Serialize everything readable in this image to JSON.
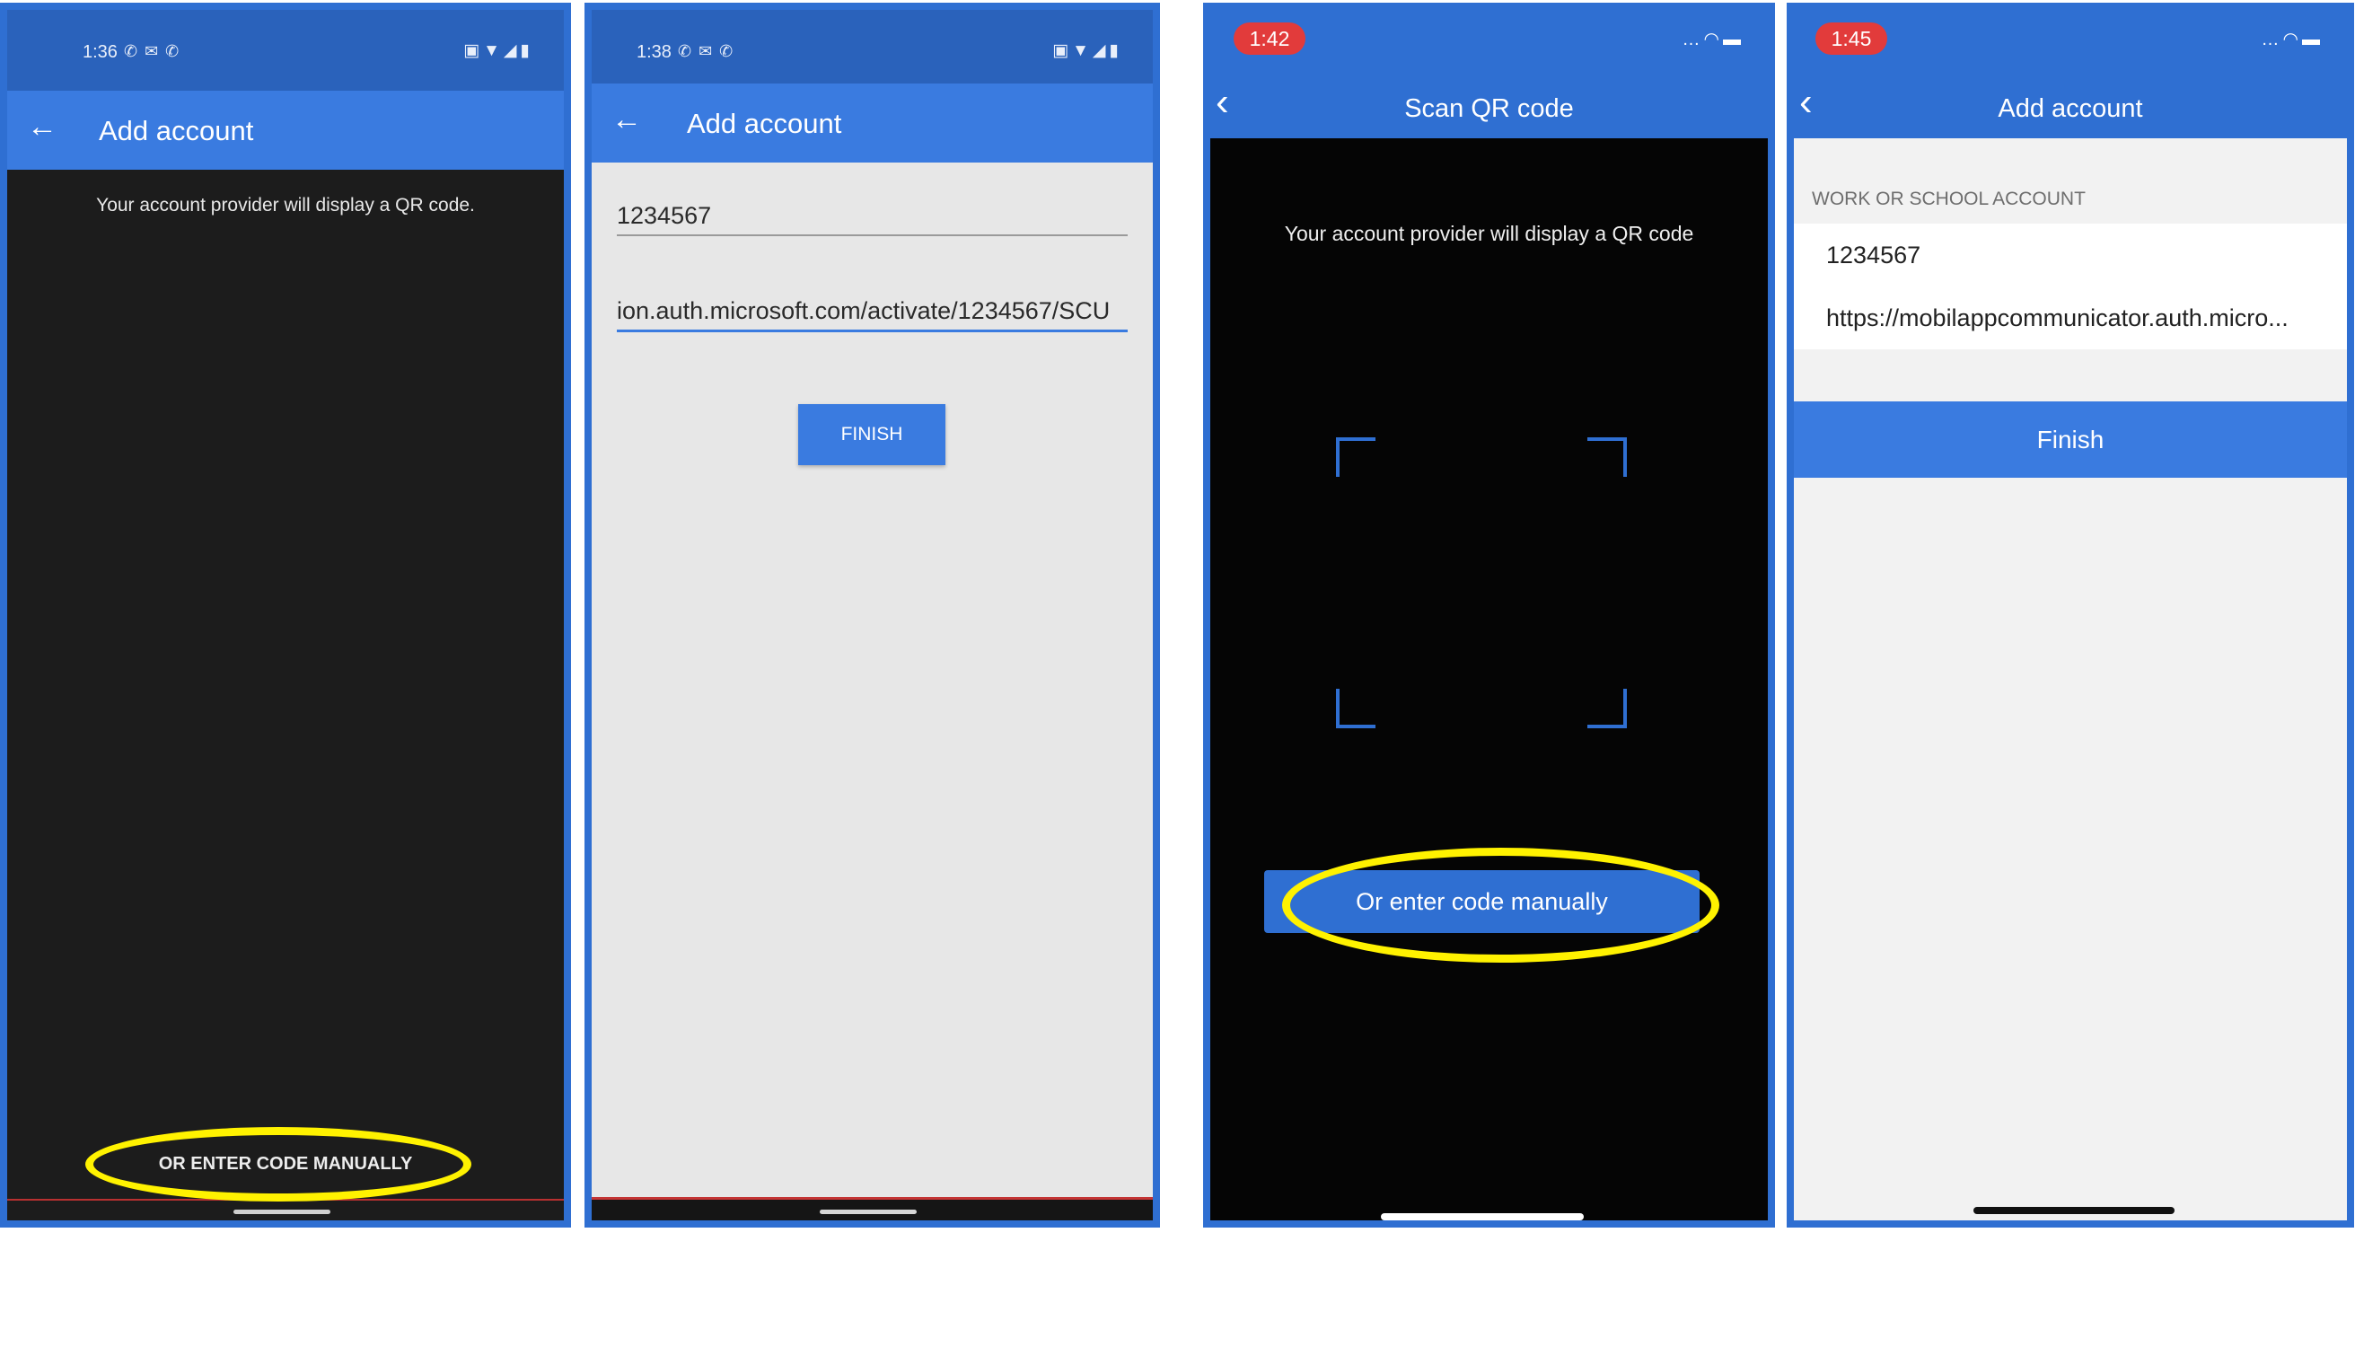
{
  "screen1": {
    "status_time": "1:36",
    "title": "Add account",
    "message": "Your account provider will display a QR code.",
    "manual_link": "OR ENTER CODE MANUALLY"
  },
  "screen2": {
    "status_time": "1:38",
    "title": "Add account",
    "code_value": "1234567",
    "url_value": "ion.auth.microsoft.com/activate/1234567/SCU",
    "finish_label": "FINISH"
  },
  "screen3": {
    "status_time": "1:42",
    "title": "Scan QR code",
    "message": "Your account provider will display a QR code",
    "manual_button": "Or enter code manually"
  },
  "screen4": {
    "status_time": "1:45",
    "title": "Add account",
    "section_header": "WORK OR SCHOOL ACCOUNT",
    "code_value": "1234567",
    "url_value": "https://mobilappcommunicator.auth.micro...",
    "finish_label": "Finish"
  },
  "icons": {
    "android_back": "arrow-left-icon",
    "ios_back": "chevron-left-icon",
    "qr_frame": "qr-scan-frame-icon"
  },
  "colors": {
    "frame_blue": "#2f6fd2",
    "appbar_blue": "#3a7be0",
    "status_blue": "#2a62bb",
    "highlight_yellow": "#fff200",
    "ios_time_pill": "#e23b3b"
  }
}
